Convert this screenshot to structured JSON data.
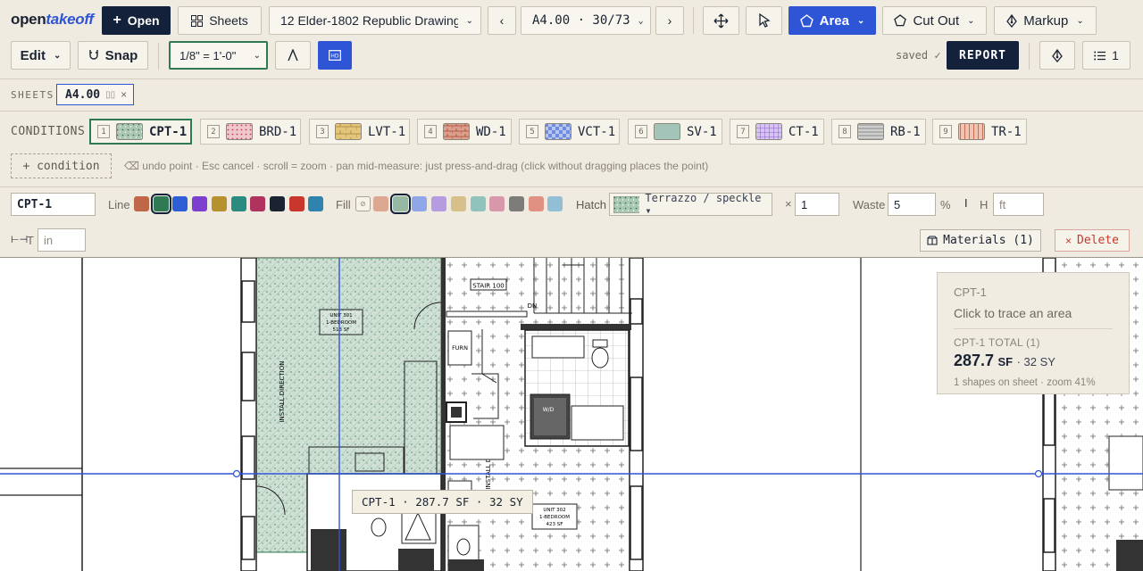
{
  "app": {
    "brand_open": "open",
    "brand_takeoff": "takeoff"
  },
  "toolbar": {
    "open_label": "Open",
    "sheets_label": "Sheets",
    "file_name": "12 Elder-1802 Republic Drawings.pdf",
    "sheet_selector": "A4.00 · 30/73",
    "area_label": "Area",
    "cutout_label": "Cut Out",
    "markup_label": "Markup",
    "edit_label": "Edit",
    "snap_label": "Snap",
    "scale_value": "1/8\" = 1'-0\"",
    "saved_text": "saved ✓",
    "report_label": "REPORT",
    "list_count": "1"
  },
  "sheets_tab": {
    "label": "SHEETS",
    "active_sheet": "A4.00"
  },
  "conditions": {
    "label": "CONDITIONS",
    "items": [
      {
        "num": "1",
        "name": "CPT-1"
      },
      {
        "num": "2",
        "name": "BRD-1"
      },
      {
        "num": "3",
        "name": "LVT-1"
      },
      {
        "num": "4",
        "name": "WD-1"
      },
      {
        "num": "5",
        "name": "VCT-1"
      },
      {
        "num": "6",
        "name": "SV-1"
      },
      {
        "num": "7",
        "name": "CT-1"
      },
      {
        "num": "8",
        "name": "RB-1"
      },
      {
        "num": "9",
        "name": "TR-1"
      }
    ],
    "add_label": "+ condition",
    "hint": "⌫ undo point · Esc cancel · scroll = zoom · pan mid-measure: just press-and-drag (click without dragging places the point)"
  },
  "editor": {
    "name_value": "CPT-1",
    "line_label": "Line",
    "line_colors": [
      "#c0674a",
      "#2f7a52",
      "#2e5ed6",
      "#7c3fd0",
      "#b8912f",
      "#2a8c80",
      "#b0325e",
      "#1b2333",
      "#c9372c",
      "#2f83ad"
    ],
    "fill_label": "Fill",
    "fill_colors": [
      "#dca892",
      "#97b8a3",
      "#8fa7e9",
      "#b79be0",
      "#d8c08a",
      "#90c3bb",
      "#d897ab",
      "#7d7c78",
      "#e09182",
      "#93bfd6"
    ],
    "hatch_label": "Hatch",
    "hatch_value": "Terrazzo / speckle ▾",
    "multiplier_label": "×",
    "multiplier_value": "1",
    "waste_label": "Waste",
    "waste_value": "5",
    "waste_unit": "%",
    "height_label": "H",
    "height_placeholder": "ft",
    "thickness_label": "T",
    "thickness_placeholder": "in",
    "materials_label": "Materials (1)",
    "delete_label": "Delete",
    "accent": "#2f7a52"
  },
  "drawing": {
    "stair_label": "STAIR 100",
    "dn_label": "DN",
    "unit301": [
      "UNIT 301",
      "1-BEDROOM",
      "513 SF"
    ],
    "unit302": [
      "UNIT 302",
      "1-BEDROOM",
      "423 SF"
    ],
    "install_direction": "INSTALL DIRECTION",
    "furn_label": "FURN",
    "wd_label": "W/D",
    "measure_tooltip": "CPT-1 · 287.7 SF · 32 SY"
  },
  "panel": {
    "condition_name": "CPT-1",
    "instruction": "Click to trace an area",
    "total_label": "CPT-1 TOTAL (1)",
    "total_value": "287.7",
    "total_unit": "SF",
    "total_secondary": "· 32 SY",
    "footer": "1 shapes on sheet · zoom 41%"
  }
}
